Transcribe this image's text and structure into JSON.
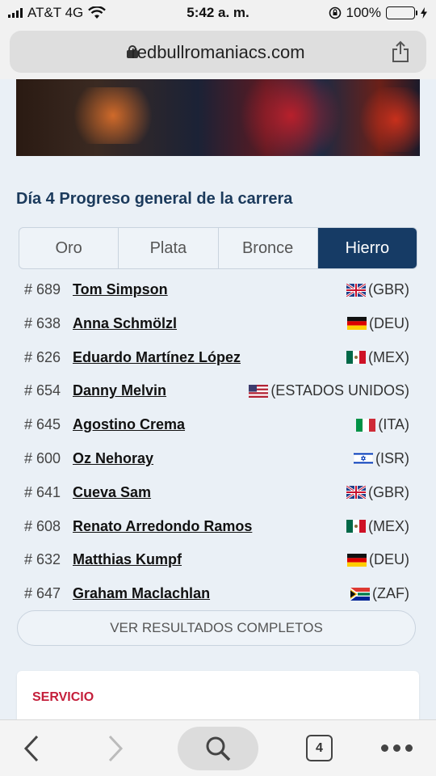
{
  "status_bar": {
    "carrier": "AT&T 4G",
    "time": "5:42 a. m.",
    "battery": "100%"
  },
  "browser": {
    "url": "redbullromaniacs.com",
    "tab_count": "4"
  },
  "section": {
    "title": "Día 4 Progreso general de la carrera"
  },
  "tabs": [
    {
      "label": "Oro",
      "active": false
    },
    {
      "label": "Plata",
      "active": false
    },
    {
      "label": "Bronce",
      "active": false
    },
    {
      "label": "Hierro",
      "active": true
    }
  ],
  "results": [
    {
      "number": "# 689",
      "name": "Tom Simpson",
      "country": "(GBR)",
      "flag": "uk-flag-icon"
    },
    {
      "number": "# 638",
      "name": "Anna Schmölzl",
      "country": "(DEU)",
      "flag": "germany-flag-icon"
    },
    {
      "number": "# 626",
      "name": "Eduardo Martínez López",
      "country": "(MEX)",
      "flag": "mexico-flag-icon"
    },
    {
      "number": "# 654",
      "name": "Danny Melvin",
      "country": "(ESTADOS UNIDOS)",
      "flag": "usa-flag-icon"
    },
    {
      "number": "# 645",
      "name": "Agostino Crema",
      "country": "(ITA)",
      "flag": "italy-flag-icon"
    },
    {
      "number": "# 600",
      "name": "Oz Nehoray",
      "country": "(ISR)",
      "flag": "israel-flag-icon"
    },
    {
      "number": "# 641",
      "name": "Cueva Sam",
      "country": "(GBR)",
      "flag": "uk-flag-icon"
    },
    {
      "number": "# 608",
      "name": "Renato Arredondo Ramos",
      "country": "(MEX)",
      "flag": "mexico-flag-icon"
    },
    {
      "number": "# 632",
      "name": "Matthias Kumpf",
      "country": "(DEU)",
      "flag": "germany-flag-icon"
    },
    {
      "number": "# 647",
      "name": "Graham Maclachlan",
      "country": "(ZAF)",
      "flag": "south-africa-flag-icon"
    }
  ],
  "full_results_button": "VER RESULTADOS COMPLETOS",
  "service_card": {
    "label": "SERVICIO"
  },
  "colors": {
    "tab_active": "#163b65",
    "title": "#1b3a5c",
    "service_label": "#c41e3a",
    "page_background": "#eaf0f6"
  }
}
